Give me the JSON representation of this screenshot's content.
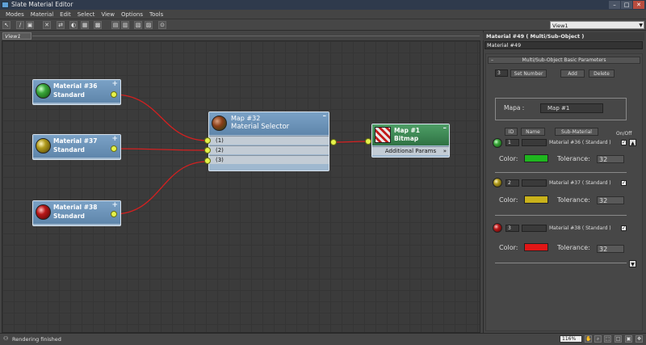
{
  "window": {
    "title": "Slate Material Editor",
    "buttons": [
      "–",
      "□",
      "✕"
    ]
  },
  "menu": [
    "Modes",
    "Material",
    "Edit",
    "Select",
    "View",
    "Options",
    "Tools"
  ],
  "toolbar": {
    "icons": [
      "select-icon",
      "eyedropper-icon",
      "assign-icon",
      "delete-icon",
      "move-children-icon",
      "hide-icon",
      "background-icon",
      "show-map-icon",
      "show-end-result-icon",
      "layout-icon",
      "layout-children-icon",
      "properties-icon",
      "material-map-browser-icon"
    ],
    "view_selector": "View1"
  },
  "view_tab": "View1",
  "nodes": {
    "mat36": {
      "title": "Material #36",
      "subtitle": "Standard",
      "plus": "+"
    },
    "mat37": {
      "title": "Material #37",
      "subtitle": "Standard",
      "plus": "+"
    },
    "mat38": {
      "title": "Material #38",
      "subtitle": "Standard",
      "plus": "+"
    },
    "map32": {
      "title": "Map #32",
      "subtitle": "Material Selector",
      "minus": "–",
      "slots": [
        "(1)",
        "(2)",
        "(3)"
      ]
    },
    "map1": {
      "title": "Map #1",
      "subtitle": "Bitmap",
      "minus": "–",
      "extra": "Additional Params",
      "extra_toggle": "»"
    }
  },
  "panel": {
    "title": "Material #49  ( Multi/Sub-Object )",
    "name_field": "Material #49",
    "rollout_title": "Multi/Sub-Object Basic Parameters",
    "rollout_toggle": "–",
    "count_value": "3",
    "set_number": "Set Number",
    "add": "Add",
    "delete": "Delete",
    "mapa_label": "Mapa :",
    "mapa_button": "Map #1",
    "col_id": "ID",
    "col_name": "Name",
    "col_submaterial": "Sub-Material",
    "col_onoff": "On/Off",
    "rows": [
      {
        "id": "1",
        "sub_material": "Material #36  ( Standard )",
        "color_label": "Color:",
        "color": "#1fb61f",
        "tolerance_label": "Tolerance:",
        "tolerance": "32",
        "checked": "✓"
      },
      {
        "id": "2",
        "sub_material": "Material #37  ( Standard )",
        "color_label": "Color:",
        "color": "#c9b21b",
        "tolerance_label": "Tolerance:",
        "tolerance": "32",
        "checked": "✓"
      },
      {
        "id": "3",
        "sub_material": "Material #38  ( Standard )",
        "color_label": "Color:",
        "color": "#e21616",
        "tolerance_label": "Tolerance:",
        "tolerance": "32",
        "checked": "✓"
      }
    ],
    "scroll_up": "▲",
    "scroll_down": "▼"
  },
  "status": {
    "text": "Rendering finished",
    "zoom": "116%"
  },
  "colors": {
    "wire": "#d42020",
    "socket": "#e5f24a",
    "node_header": "#6f95ba",
    "bitmap_header": "#3f8a55"
  }
}
